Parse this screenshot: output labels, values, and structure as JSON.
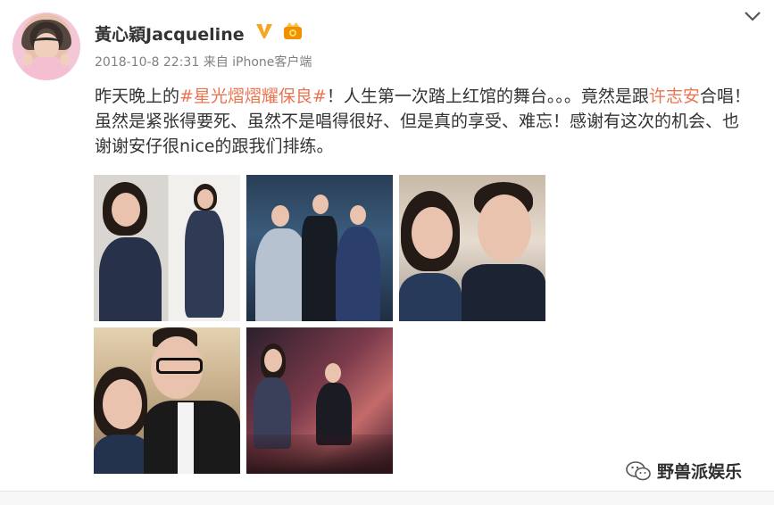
{
  "user": {
    "name": "黃心穎Jacqueline",
    "avatar_icon": "user-avatar",
    "verified_icon": "verified-v-icon",
    "level_icon": "member-badge-icon"
  },
  "meta": {
    "timestamp": "2018-10-8 22:31",
    "source": "来自 iPhone客户端"
  },
  "post": {
    "text_part1": "昨天晚上的",
    "hashtag": "#星光熠熠耀保良#",
    "text_part2": "！人生第一次踏上红馆的舞台。。。竟然是跟",
    "mention": "许志安",
    "text_part3": "合唱！虽然是紧张得要死、虽然不是唱得很好、但是真的享受、难忘！感谢有这次的机会、也谢谢安仔很nice的跟我们排练。"
  },
  "photos": [
    {
      "name": "photo-1"
    },
    {
      "name": "photo-2"
    },
    {
      "name": "photo-3"
    },
    {
      "name": "photo-4"
    },
    {
      "name": "photo-5"
    }
  ],
  "watermark": {
    "icon": "wechat-icon",
    "text": "野兽派娱乐"
  },
  "colors": {
    "accent": "#eb7350",
    "text": "#333333",
    "meta": "#808080",
    "verified": "#f5a623"
  }
}
